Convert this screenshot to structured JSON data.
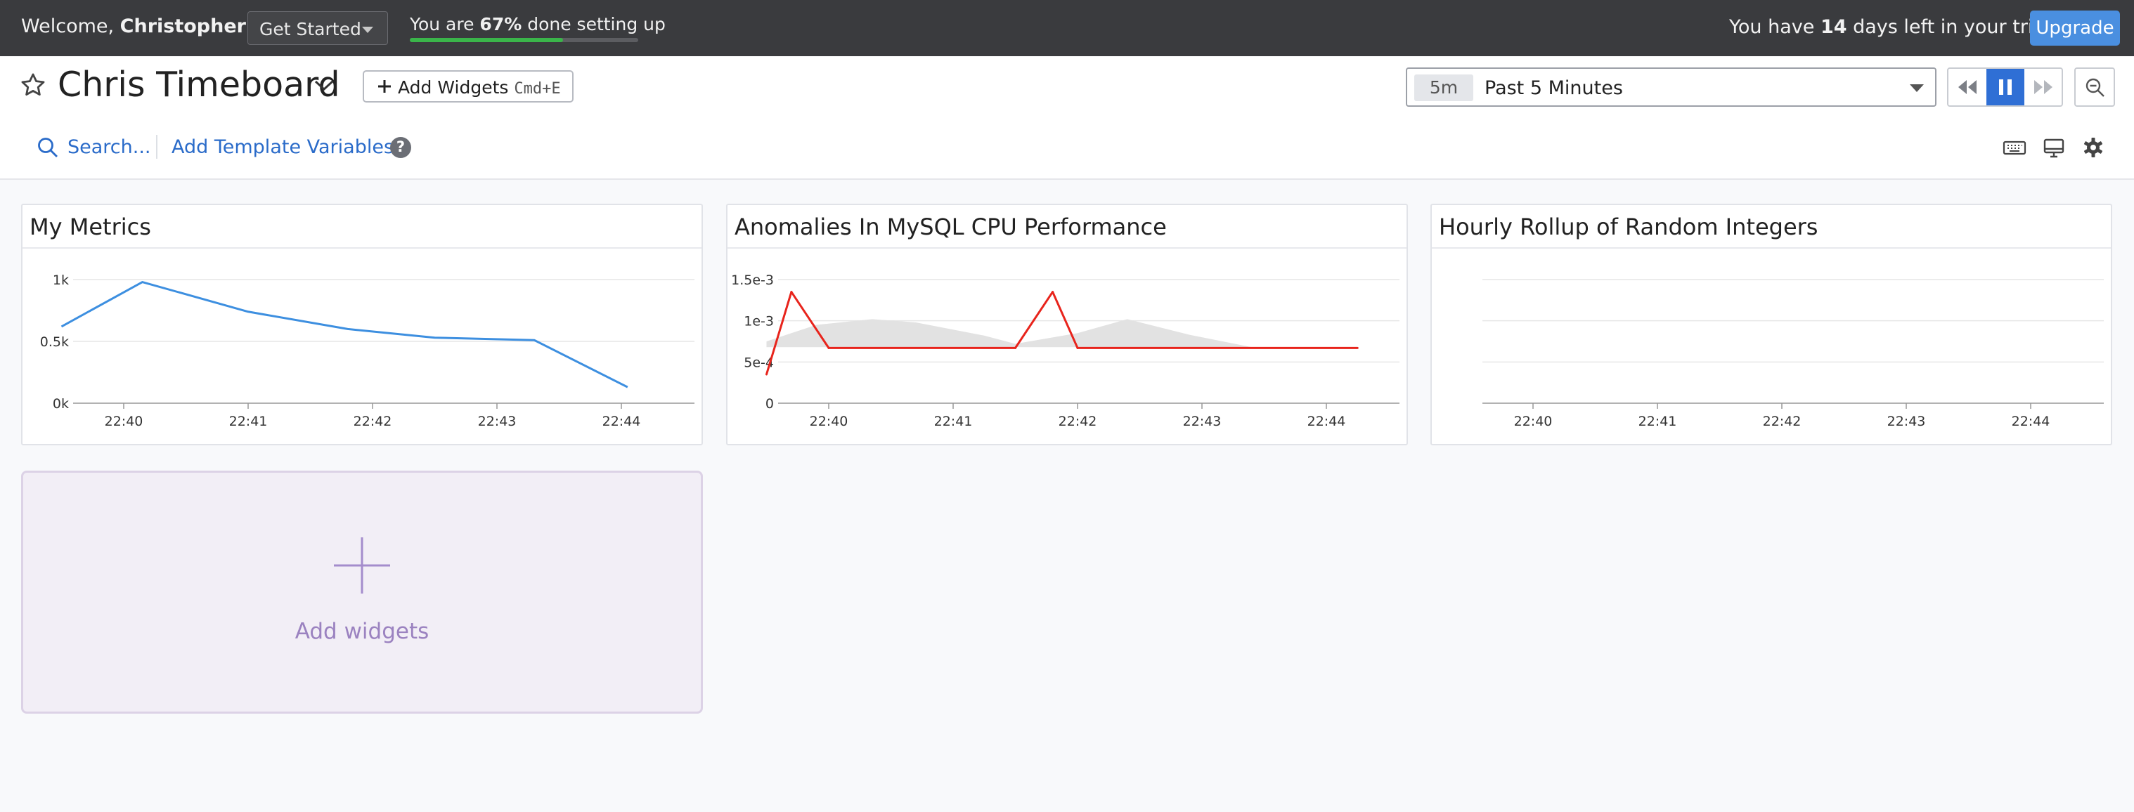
{
  "topbar": {
    "welcome_prefix": "Welcome, ",
    "user_name": "Christopher",
    "welcome_suffix": "!",
    "get_started_label": "Get Started",
    "progress_prefix": "You are ",
    "progress_percent_text": "67%",
    "progress_suffix": " done setting up",
    "progress_fraction": 0.67,
    "trial_prefix": "You have ",
    "trial_days": "14",
    "trial_suffix": " days left in your trial.",
    "upgrade_label": "Upgrade"
  },
  "header": {
    "title": "Chris Timeboard",
    "add_widgets_label": "Add Widgets",
    "add_widgets_shortcut": "Cmd+E",
    "time_short": "5m",
    "time_label": "Past 5 Minutes",
    "search_label": "Search...",
    "template_vars_label": "Add Template Variables",
    "help_symbol": "?"
  },
  "icons": {
    "star": "star-icon",
    "title_caret": "chevron-down-icon",
    "plus": "plus-icon",
    "rewind": "rewind-icon",
    "pause": "pause-icon",
    "forward": "fast-forward-icon",
    "zoom_out": "zoom-out-icon",
    "search": "search-icon",
    "help": "help-icon",
    "keyboard": "keyboard-icon",
    "tv_mode": "monitor-icon",
    "settings": "gear-icon"
  },
  "colors": {
    "accent_blue": "#2a6bc9",
    "upgrade_blue": "#4a8fe0",
    "progress_green": "#3ab54a",
    "series_blue": "#3d8fe0",
    "anomaly_red": "#e8241c",
    "normal_purple": "#7a4fe0",
    "band_gray": "#e2e2e2"
  },
  "widgets": [
    {
      "title": "My Metrics"
    },
    {
      "title": "Anomalies In MySQL CPU Performance"
    },
    {
      "title": "Hourly Rollup of Random Integers"
    }
  ],
  "add_widgets_card": {
    "label": "Add widgets"
  },
  "chart_data": [
    {
      "type": "line",
      "title": "My Metrics",
      "x_ticks": [
        "22:40",
        "22:41",
        "22:42",
        "22:43",
        "22:44"
      ],
      "y_ticks": [
        "0k",
        "0.5k",
        "1k"
      ],
      "ylim": [
        0,
        1000
      ],
      "x": [
        "22:39.5",
        "22:40.15",
        "22:41",
        "22:41.8",
        "22:42.5",
        "22:43.3",
        "22:44.05"
      ],
      "series": [
        {
          "values": [
            620,
            980,
            740,
            600,
            530,
            510,
            130
          ]
        }
      ],
      "grid": true
    },
    {
      "type": "line",
      "title": "Anomalies In MySQL CPU Performance",
      "x_ticks": [
        "22:40",
        "22:41",
        "22:42",
        "22:43",
        "22:44"
      ],
      "y_ticks": [
        "0",
        "5e-4",
        "1e-3",
        "1.5e-3"
      ],
      "ylim": [
        0,
        0.0015
      ],
      "x": [
        "22:39.5",
        "22:39.7",
        "22:40",
        "22:41.5",
        "22:41.8",
        "22:42",
        "22:44.25"
      ],
      "series": [
        {
          "values": [
            0.00035,
            0.00135,
            0.00067,
            0.00067,
            0.00135,
            0.00067,
            0.00067
          ]
        }
      ],
      "anomaly_band": {
        "x": [
          "22:39.5",
          "22:39.9",
          "22:40.35",
          "22:40.7",
          "22:41.25",
          "22:41.5",
          "22:42",
          "22:42.4",
          "22:42.9",
          "22:43.4",
          "22:44.25"
        ],
        "upper": [
          0.00075,
          0.00095,
          0.00102,
          0.00098,
          0.00082,
          0.00072,
          0.00085,
          0.00102,
          0.00083,
          0.00068,
          0.00068
        ],
        "lower": [
          0.00068,
          0.00068,
          0.00068,
          0.00068,
          0.00068,
          0.00068,
          0.00068,
          0.00068,
          0.00068,
          0.00068,
          0.00068
        ]
      },
      "grid": true
    },
    {
      "type": "line",
      "title": "Hourly Rollup of Random Integers",
      "x_ticks": [
        "22:40",
        "22:41",
        "22:42",
        "22:43",
        "22:44"
      ],
      "y_ticks": [],
      "series": [],
      "grid": true
    }
  ]
}
